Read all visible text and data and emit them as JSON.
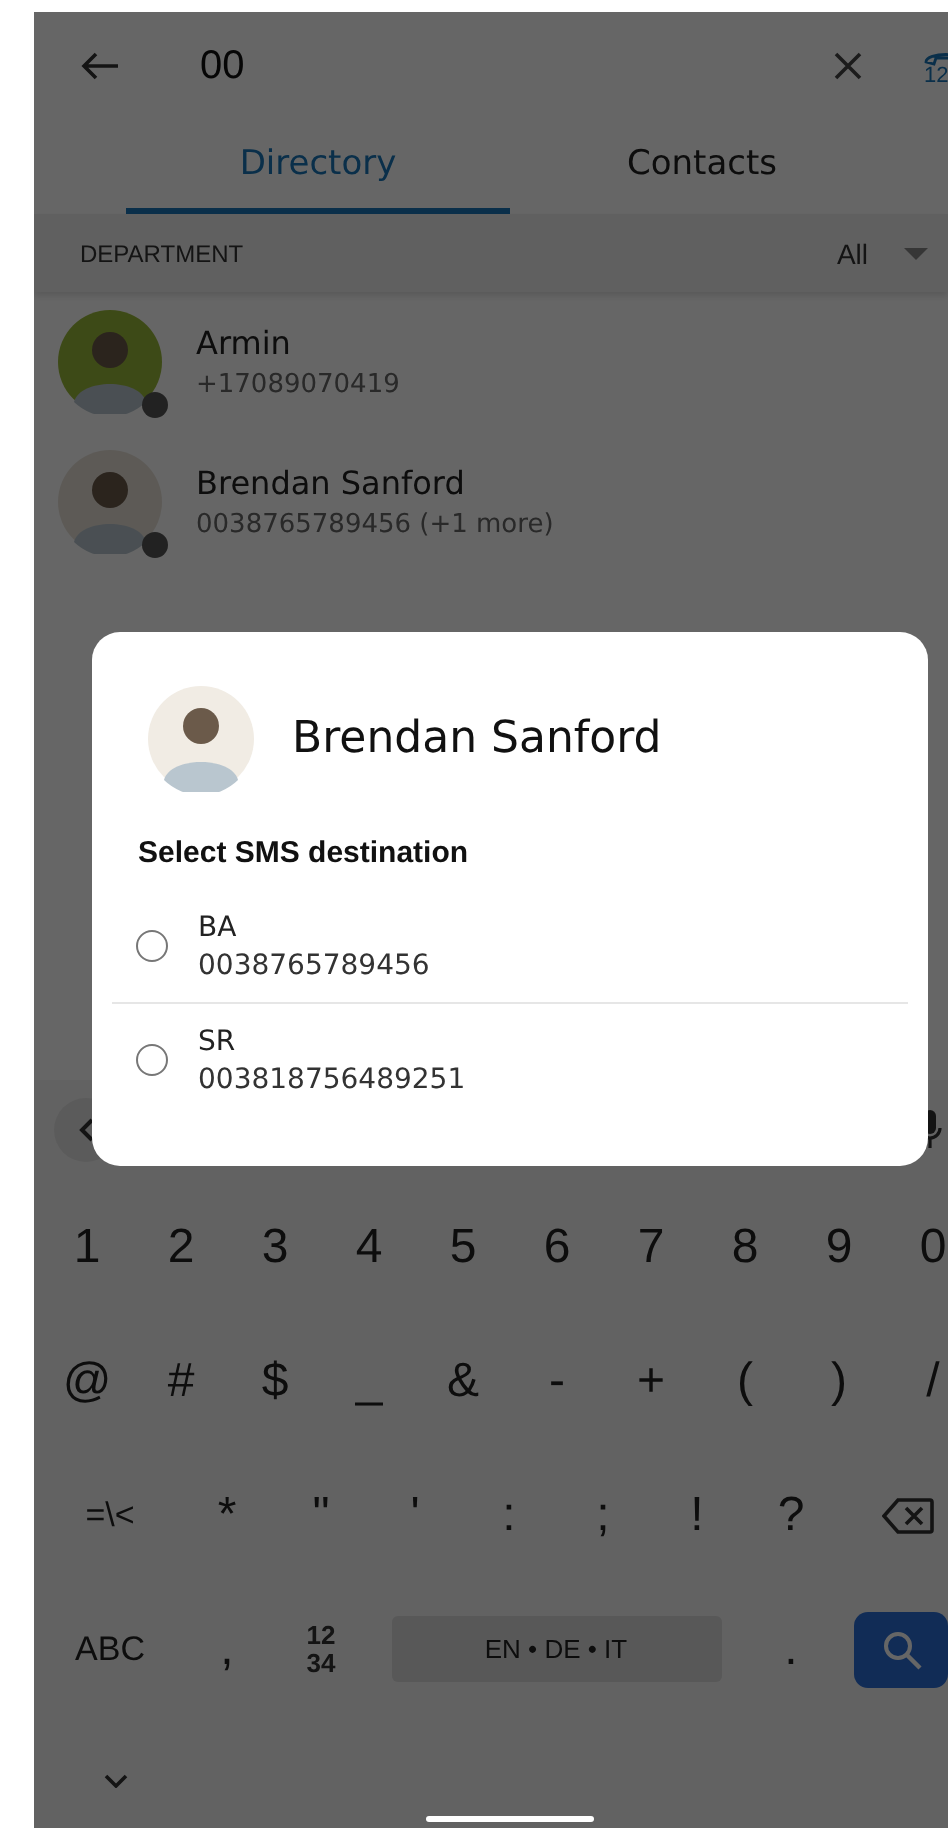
{
  "header": {
    "query": "00",
    "keypad_icon_text": "12"
  },
  "tabs": [
    {
      "label": "Directory",
      "selected": true
    },
    {
      "label": "Contacts",
      "selected": false
    }
  ],
  "filter": {
    "label": "DEPARTMENT",
    "value": "All"
  },
  "contacts": [
    {
      "name": "Armin",
      "number": "+17089070419",
      "online": false
    },
    {
      "name": "Brendan Sanford",
      "number": "0038765789456 (+1 more)",
      "online": false
    }
  ],
  "dialog": {
    "name": "Brendan Sanford",
    "heading": "Select SMS destination",
    "options": [
      {
        "label": "BA",
        "number": "0038765789456",
        "selected": false
      },
      {
        "label": "SR",
        "number": "003818756489251",
        "selected": false
      }
    ]
  },
  "keyboard": {
    "rows": [
      {
        "keys": [
          {
            "kind": "char",
            "label": "1"
          },
          {
            "kind": "char",
            "label": "2"
          },
          {
            "kind": "char",
            "label": "3"
          },
          {
            "kind": "char",
            "label": "4"
          },
          {
            "kind": "char",
            "label": "5"
          },
          {
            "kind": "char",
            "label": "6"
          },
          {
            "kind": "char",
            "label": "7"
          },
          {
            "kind": "char",
            "label": "8"
          },
          {
            "kind": "char",
            "label": "9"
          },
          {
            "kind": "char",
            "label": "0"
          }
        ]
      },
      {
        "keys": [
          {
            "kind": "char",
            "label": "@"
          },
          {
            "kind": "char",
            "label": "#"
          },
          {
            "kind": "char",
            "label": "$"
          },
          {
            "kind": "char",
            "label": "_"
          },
          {
            "kind": "char",
            "label": "&"
          },
          {
            "kind": "char",
            "label": "-"
          },
          {
            "kind": "char",
            "label": "+"
          },
          {
            "kind": "char",
            "label": "("
          },
          {
            "kind": "char",
            "label": ")"
          },
          {
            "kind": "char",
            "label": "/"
          }
        ]
      },
      {
        "keys": [
          {
            "kind": "wide",
            "label": "=\\<"
          },
          {
            "kind": "char",
            "label": "*"
          },
          {
            "kind": "char",
            "label": "\""
          },
          {
            "kind": "char",
            "label": "'"
          },
          {
            "kind": "char",
            "label": ":"
          },
          {
            "kind": "char",
            "label": ";"
          },
          {
            "kind": "char",
            "label": "!"
          },
          {
            "kind": "char",
            "label": "?"
          },
          {
            "kind": "backspace"
          }
        ]
      },
      {
        "keys": [
          {
            "kind": "wide",
            "label": "ABC"
          },
          {
            "kind": "char",
            "label": ","
          },
          {
            "kind": "stack",
            "lines": [
              "12",
              "34"
            ]
          },
          {
            "kind": "space",
            "label": "EN • DE • IT"
          },
          {
            "kind": "char",
            "label": "."
          },
          {
            "kind": "search"
          }
        ]
      }
    ]
  }
}
